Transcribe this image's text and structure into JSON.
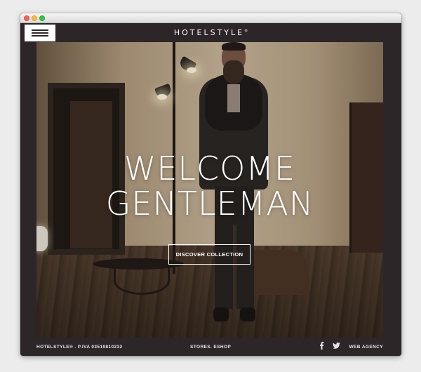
{
  "site": {
    "logo": "HOTELSTYLE",
    "logo_mark": "®"
  },
  "hero": {
    "headline_line1": "WELCOME",
    "headline_line2": "GENTLEMAN",
    "cta_label": "DISCOVER COLLECTION"
  },
  "footer": {
    "company": "HOTELSTYLE® . P.IVA 03519810232",
    "nav": "STORES. ESHOP",
    "social": [
      "facebook-icon",
      "twitter-icon"
    ],
    "agency": "WEB AGENCY"
  },
  "colors": {
    "frame": "#2d2629",
    "text": "#ffffff"
  }
}
